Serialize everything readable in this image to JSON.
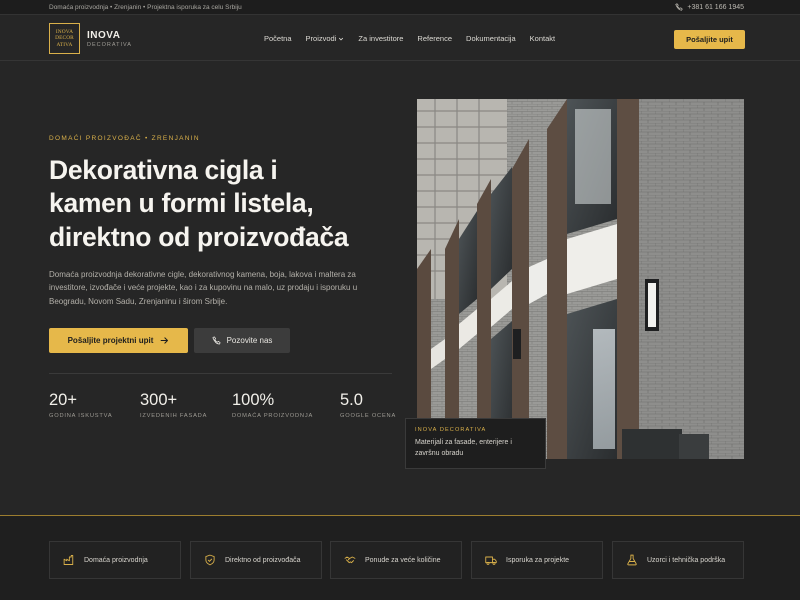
{
  "topbar": {
    "breadcrumb": "Domaća proizvodnja • Zrenjanin • Projektna isporuka za celu Srbiju",
    "phone": "+381 61 166 1945",
    "phone_icon": "phone-icon"
  },
  "nav": {
    "logo_lines": [
      "INOVA",
      "DECOR",
      "ATIVA"
    ],
    "brand": "INOVA",
    "brand_sub": "DECORATIVA",
    "items": [
      {
        "label": "Početna"
      },
      {
        "label": "Proizvodi",
        "has_dropdown": true,
        "icon": "chevron-down-icon"
      },
      {
        "label": "Za investitore"
      },
      {
        "label": "Reference"
      },
      {
        "label": "Dokumentacija"
      },
      {
        "label": "Kontakt"
      }
    ],
    "cta": "Pošaljite upit"
  },
  "hero": {
    "eyebrow": "DOMAĆI PROIZVOĐAČ • ZRENJANIN",
    "headline_lines": [
      "Dekorativna cigla i",
      "kamen u formi listela,",
      "direktno od proizvođača"
    ],
    "lead": "Domaća proizvodnja dekorativne cigle, dekorativnog kamena, boja, lakova i maltera za investitore, izvođače i veće projekte, kao i za kupovinu na malo, uz prodaju i isporuku u Beogradu, Novom Sadu, Zrenjaninu i širom Srbije.",
    "primary_button": "Pošaljite projektni upit",
    "primary_icon": "arrow-right-icon",
    "secondary_button": "Pozovite nas",
    "secondary_icon": "phone-icon"
  },
  "stats": [
    {
      "value": "20+",
      "label": "GODINA ISKUSTVA"
    },
    {
      "value": "300+",
      "label": "IZVEDENIH FASADA"
    },
    {
      "value": "100%",
      "label": "DOMAĆA PROIZVODNJA"
    },
    {
      "value": "5.0",
      "label": "GOOGLE OCENA"
    }
  ],
  "photo_caption": {
    "title": "INOVA DECORATIVA",
    "text": "Materijali za fasade, enterijere i završnu obradu"
  },
  "features": [
    {
      "label": "Domaća proizvodnja",
      "icon": "factory-icon"
    },
    {
      "label": "Direktno od proizvođača",
      "icon": "shield-check-icon"
    },
    {
      "label": "Ponude za veće količine",
      "icon": "handshake-icon"
    },
    {
      "label": "Isporuka za projekte",
      "icon": "truck-icon"
    },
    {
      "label": "Uzorci i tehnička podrška",
      "icon": "flask-icon"
    }
  ],
  "colors": {
    "accent": "#e6b84a",
    "background": "#262626",
    "text": "#f6f4ef"
  }
}
